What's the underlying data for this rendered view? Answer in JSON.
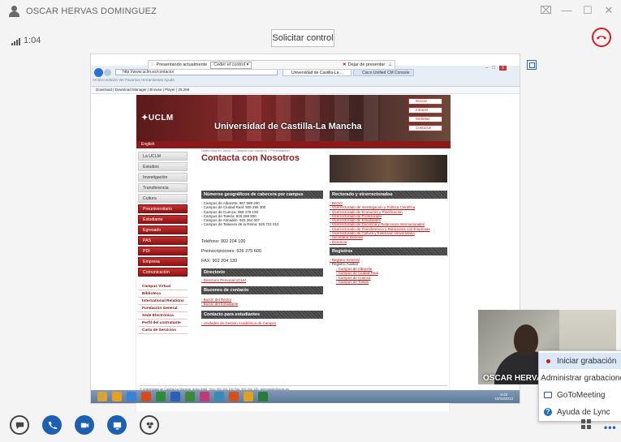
{
  "window": {
    "title": "OSCAR HERVAS DOMINGUEZ",
    "controls": [
      "⌧",
      "—",
      "☐",
      "✕"
    ]
  },
  "call": {
    "signal_label": "1:04",
    "request_control": "Solicitar control",
    "hangup_icon": "phone-hangup-icon"
  },
  "presenting_bar": {
    "label": "Presentando actualmente",
    "ceder": "Ceder el control ▾",
    "stop": "Dejar de presentar"
  },
  "browser": {
    "address": "http://www.uclm.es/contacto/",
    "tab_active": "Universidad de Castilla-La ...",
    "tab_other": "Cisco Unified CM Console",
    "menu_line": "Archivo   Edición   Ver   Favoritos   Herramientas   Ayuda",
    "fav_line": "Download  |  Download Manager  |  Browse  |  Player  |  25,266"
  },
  "website": {
    "logo": "✦UCLM",
    "university": "Universidad de Castilla-La Mancha",
    "quick_links": [
      "Buscar",
      "Intranet",
      "WebMail",
      "Contactar"
    ],
    "english": "English",
    "breadcrumb": "Usted está en: Inicio > Contacto con nosotros > Presentación",
    "page_title": "Contacta con Nosotros",
    "sidenav_gray": [
      "La UCLM",
      "Estudios",
      "Investigación",
      "Transferencia",
      "Cultura"
    ],
    "sidenav_red": [
      "Preuniversitario",
      "Estudiante",
      "Egresado",
      "PAS",
      "PDI",
      "Empresa",
      "Comunicación"
    ],
    "sidenav_links": [
      "Campus Virtual",
      "Biblioteca",
      "International Relations",
      "Fundación General",
      "Sede Electrónica",
      "Perfil del contratante",
      "Carta de Servicios"
    ],
    "sec_numeros": "Números geográficos de cabecera por campus",
    "numeros": [
      "Campus de Albacete: 967 599 200",
      "Campus de Ciudad Real: 926 295 300",
      "Campus de Cuenca: 969 179 100",
      "Campus de Toledo: 925 268 800",
      "Campus de Almadén: 926 264 007",
      "Campus de Talavera de la Reina: 925 721 010"
    ],
    "telefono": "Teléfono: 902 204 100",
    "preinscripciones": "Preinscripciones: 926 275 600",
    "fax": "FAX: 902 204 130",
    "sec_directorio": "Directorio",
    "directorio": [
      "Directorio Personal UCLM"
    ],
    "sec_buzones": "Buzones de contacto",
    "buzones": [
      "Buzón del Rector",
      "Buzón del Estudiante"
    ],
    "sec_contacto": "Contacto para estudiantes",
    "contacto": [
      "Unidades de Gestión Académica de Campus"
    ],
    "sec_rectorado": "Rectorado y vicerrectorados",
    "rectorado": [
      "Rector",
      "Vicerrectorado de Investigación y Política Científica",
      "Vicerrectorado de Economía y Planificación",
      "Vicerrectorado de Profesorado",
      "Vicerrectorado de Estudiantes",
      "Vicerrectorado de Docencia y Relaciones Internacionales",
      "Vicerrectorado de Transferencia y Relaciones con Empresas",
      "Vicerrectorado de Cultura y Extensión Universitaria",
      "Secretaría General",
      "Gerencia"
    ],
    "sec_registros": "Registros",
    "registros_top": [
      "Registro General",
      "Registro Auxiliar"
    ],
    "registros_sub": [
      "Campus de Albacete",
      "Campus de Ciudad Real",
      "Campus de Cuenca",
      "Campus de Toledo"
    ],
    "footer1": "© Universidad de Castilla-La Mancha. Aviso legal. Tfno: 902 204 100 Fax: 902 204 130. webmaster@uclm.es",
    "footer2": "Web optimizada para Mozilla Firefox 4 / IE. Resolución 1024x768. Última modificación: 16/09/2013 16:50:15. Este sitio cumple los siguientes estándares XHTML 1.0, CSS, WAI-AA"
  },
  "taskbar": {
    "time": "9:42",
    "date": "16/10/2013",
    "icon_colors": [
      "#d9a23a",
      "#e8a020",
      "#3b7fd6",
      "#d94a1a",
      "#2d8a3a",
      "#2b5fb8",
      "#3a8a3a",
      "#c03a7a",
      "#3a8ab8",
      "#d6501f",
      "#e0a020",
      "#2a7a3a"
    ]
  },
  "self_video": {
    "name": "OSCAR HERVAS DOMINGUEZ"
  },
  "popup_menu": {
    "items": [
      "Iniciar grabación",
      "Administrar grabaciones",
      "GoToMeeting",
      "Ayuda de Lync"
    ]
  },
  "toolbar": {
    "more": "•••"
  },
  "colors": {
    "accent_blue": "#1d5fb3",
    "hangup_red": "#d81b1b",
    "uclm_red": "#8b1b1b"
  }
}
